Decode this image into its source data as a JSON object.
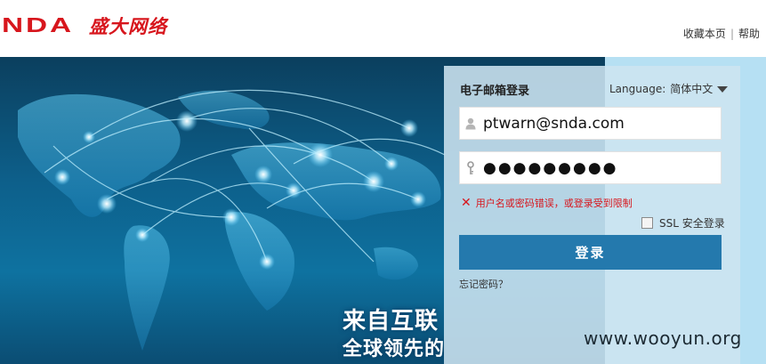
{
  "header": {
    "logo_latin": "NDA",
    "logo_cn": "盛大网络",
    "links": {
      "bookmark": "收藏本页",
      "separator": "|",
      "help": "帮助"
    }
  },
  "banner": {
    "slogan_line1": "来自互联",
    "slogan_line2": "全球领先的"
  },
  "login": {
    "title": "电子邮箱登录",
    "language_label": "Language:",
    "language_value": "简体中文",
    "email_value": "ptwarn@snda.com",
    "password_value": "●●●●●●●●●",
    "error_message": "用户名或密码错误，或登录受到限制",
    "ssl_label": "SSL 安全登录",
    "ssl_checked": false,
    "submit_label": "登录",
    "forgot_label": "忘记密码？"
  },
  "watermark": "www.wooyun.org",
  "icons": {
    "user": "user-icon",
    "key": "key-icon",
    "error": "error-x-icon",
    "dropdown": "chevron-down-icon"
  },
  "colors": {
    "brand_red": "#d7161d",
    "button_blue": "#2479ad",
    "panel_bg": "#cde4f0",
    "error_red": "#d7161d"
  }
}
